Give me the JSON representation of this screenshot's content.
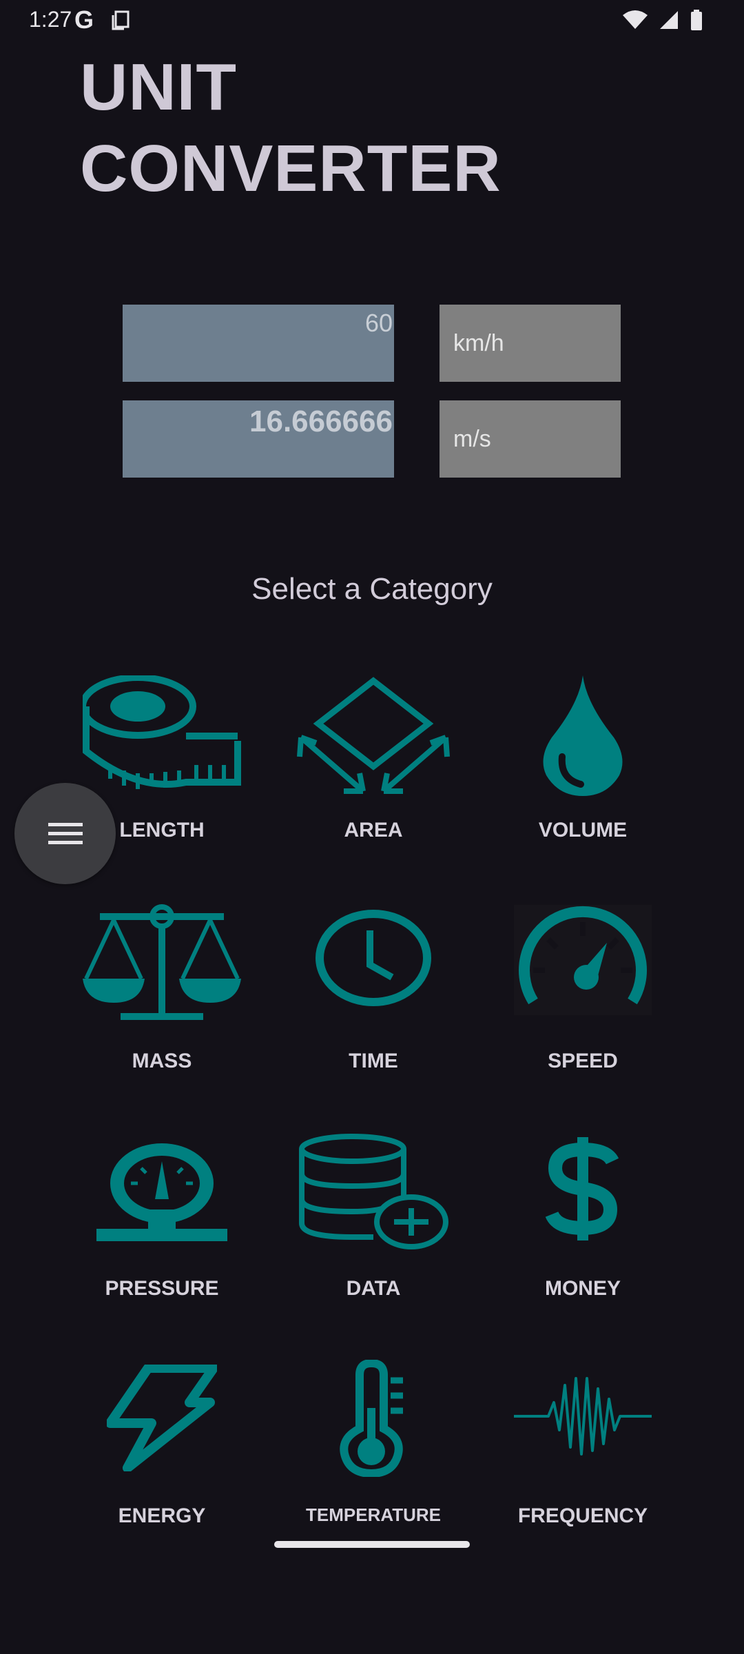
{
  "status": {
    "time": "1:27",
    "g": "G"
  },
  "title": "UNIT\nCONVERTER",
  "converter": {
    "input_value": "60",
    "input_unit": "km/h",
    "output_value": "16.666666",
    "output_unit": "m/s"
  },
  "select_label": "Select a Category",
  "categories": [
    {
      "label": "LENGTH",
      "icon": "tape-measure-icon"
    },
    {
      "label": "AREA",
      "icon": "area-icon"
    },
    {
      "label": "VOLUME",
      "icon": "drop-icon"
    },
    {
      "label": "MASS",
      "icon": "scale-icon"
    },
    {
      "label": "TIME",
      "icon": "clock-icon"
    },
    {
      "label": "SPEED",
      "icon": "speedometer-icon"
    },
    {
      "label": "PRESSURE",
      "icon": "pressure-gauge-icon"
    },
    {
      "label": "DATA",
      "icon": "database-icon"
    },
    {
      "label": "MONEY",
      "icon": "dollar-icon"
    },
    {
      "label": "ENERGY",
      "icon": "lightning-icon"
    },
    {
      "label": "TEMPERATURE",
      "icon": "thermometer-icon"
    },
    {
      "label": "FREQUENCY",
      "icon": "waveform-icon"
    }
  ],
  "colors": {
    "accent": "#008080",
    "background": "#131118"
  }
}
